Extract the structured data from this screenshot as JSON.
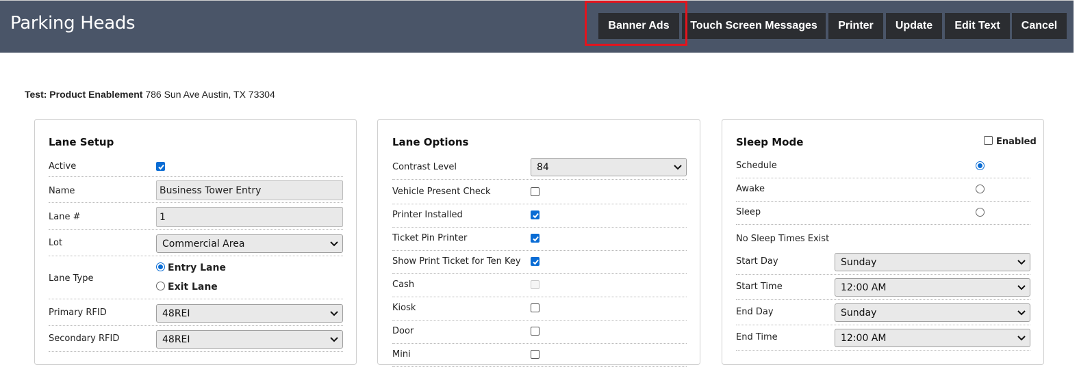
{
  "header": {
    "title": "Parking Heads",
    "buttons": {
      "banner_ads": "Banner Ads",
      "touch_screen": "Touch Screen Messages",
      "printer": "Printer",
      "update": "Update",
      "edit_text": "Edit Text",
      "cancel": "Cancel"
    }
  },
  "location": {
    "name": "Test: Product Enablement",
    "address": "786 Sun Ave Austin,  TX  73304"
  },
  "lane_setup": {
    "title": "Lane Setup",
    "active_label": "Active",
    "active": true,
    "name_label": "Name",
    "name_value": "Business Tower Entry",
    "lane_no_label": "Lane #",
    "lane_no_value": "1",
    "lot_label": "Lot",
    "lot_value": "Commercial Area",
    "lane_type_label": "Lane Type",
    "lane_type_entry": "Entry Lane",
    "lane_type_exit": "Exit Lane",
    "lane_type_selected": "Entry Lane",
    "primary_rfid_label": "Primary RFID",
    "primary_rfid_value": "48REI",
    "secondary_rfid_label": "Secondary RFID",
    "secondary_rfid_value": "48REI"
  },
  "lane_options": {
    "title": "Lane Options",
    "contrast_label": "Contrast Level",
    "contrast_value": "84",
    "items": [
      {
        "label": "Vehicle Present Check",
        "checked": false
      },
      {
        "label": "Printer Installed",
        "checked": true
      },
      {
        "label": "Ticket Pin Printer",
        "checked": true
      },
      {
        "label": "Show Print Ticket for Ten Key",
        "checked": true
      },
      {
        "label": "Cash",
        "checked": false,
        "disabled": true
      },
      {
        "label": "Kiosk",
        "checked": false
      },
      {
        "label": "Door",
        "checked": false
      },
      {
        "label": "Mini",
        "checked": false
      }
    ]
  },
  "sleep_mode": {
    "title": "Sleep Mode",
    "enabled_label": "Enabled",
    "enabled": false,
    "modes": [
      {
        "label": "Schedule",
        "selected": true
      },
      {
        "label": "Awake",
        "selected": false
      },
      {
        "label": "Sleep",
        "selected": false
      }
    ],
    "no_times": "No Sleep Times Exist",
    "start_day_label": "Start Day",
    "start_day_value": "Sunday",
    "start_time_label": "Start Time",
    "start_time_value": "12:00 AM",
    "end_day_label": "End Day",
    "end_day_value": "Sunday",
    "end_time_label": "End Time",
    "end_time_value": "12:00 AM"
  },
  "colors": {
    "header_bg": "#4a5568",
    "button_bg": "#2b2d31",
    "accent": "#0a6cd4",
    "highlight": "#e3141d"
  }
}
